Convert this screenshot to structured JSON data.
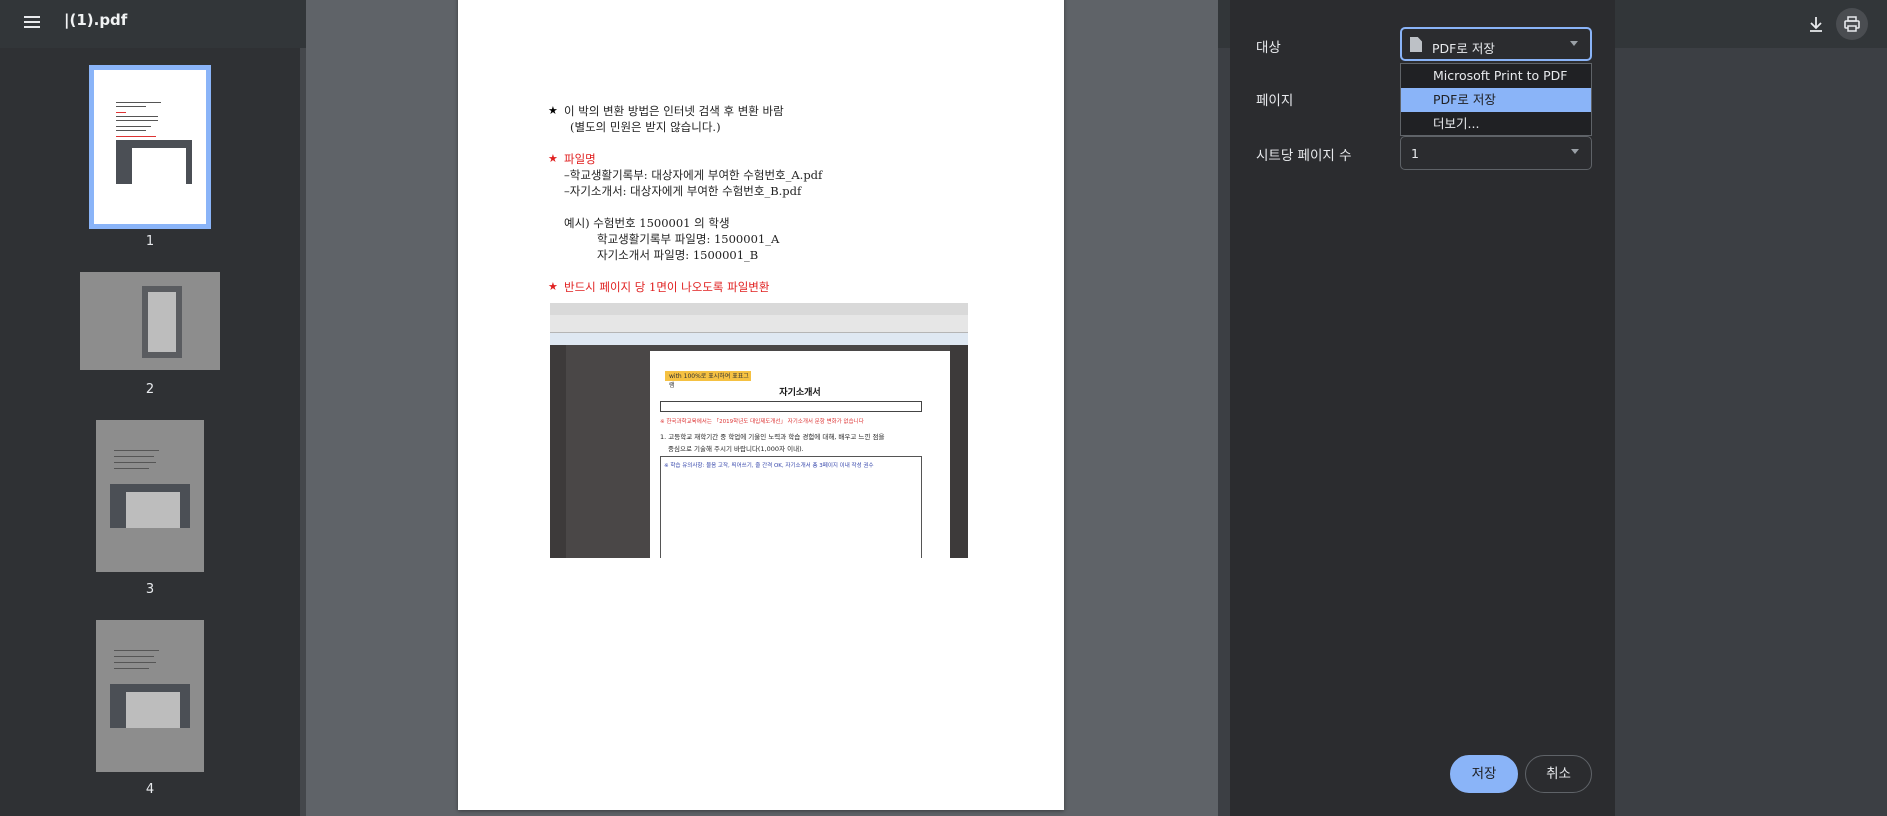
{
  "toolbar": {
    "file_title": "|(1).pdf",
    "icons": [
      "menu-icon",
      "download-icon",
      "print-icon"
    ]
  },
  "thumbnails": [
    {
      "label": "1",
      "selected": true
    },
    {
      "label": "2",
      "selected": false
    },
    {
      "label": "3",
      "selected": false
    },
    {
      "label": "4",
      "selected": false
    }
  ],
  "document": {
    "line1": "이 박의 변환 방법은 인터넷 검색 후 변환 바람",
    "line2": "(별도의 민원은 받지 않습니다.)",
    "section_filename": "파일명",
    "item1": "–학교생활기록부:  대상자에게 부여한 수험번호_A.pdf",
    "item2": "–자기소개서:  대상자에게 부여한 수험번호_B.pdf",
    "example1": "예시)  수험번호  1500001 의  학생",
    "example2": "학교생활기록부  파일명:  1500001_A",
    "example3": "자기소개서  파일명:  1500001_B",
    "section_one_page": "반드시  페이지  당  1면이  나오도록  파일변환",
    "star": "★",
    "embedded": {
      "tag": "with 100%로 표시하여 표표그램",
      "title": "자기소개서",
      "red_note": "※ 한국과학교육에서는 「2019학년도 대입제도개선」 자기소개서 문항 변화가 없습니다",
      "question": "1. 고등학교 재학기간 중 학업에 기울인 노력과 학습 경험에 대해, 배우고 느낀 점을",
      "question2": "중심으로 기술해 주시기 바랍니다(1,000자 이내).",
      "box_note": "※ 학습 유의사항: 물음 고작, 띄어쓰기, 줄 간격 OK, 자기소개서 총 3페이지 이내 작성 권수"
    }
  },
  "print_panel": {
    "destination_label": "대상",
    "destination_value": "PDF로 저장",
    "pages_label": "페이지",
    "pages_per_sheet_label": "시트당 페이지 수",
    "pages_per_sheet_value": "1",
    "dropdown_options": [
      {
        "label": "Microsoft Print to PDF",
        "selected": false
      },
      {
        "label": "PDF로 저장",
        "selected": true
      },
      {
        "label": "더보기...",
        "selected": false
      }
    ],
    "save_label": "저장",
    "cancel_label": "취소"
  },
  "colors": {
    "accent": "#8ab4f8",
    "panel_bg": "#2b2c2f",
    "viewer_bg": "#5f6368",
    "red_text": "#e02020"
  }
}
